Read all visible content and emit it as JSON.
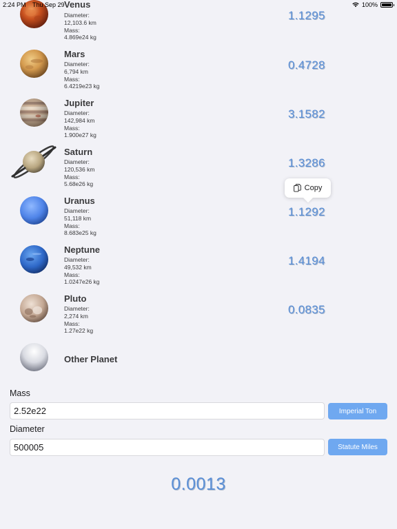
{
  "status_bar": {
    "time": "2:24 PM",
    "date": "Thu Sep 29",
    "battery": "100%"
  },
  "planets": [
    {
      "name": "Venus",
      "diameter_label": "Diameter:",
      "diameter": "12,103.6 km",
      "mass_label": "Mass:",
      "mass": "4.869e24 kg",
      "value": "1.1295"
    },
    {
      "name": "Mars",
      "diameter_label": "Diameter:",
      "diameter": "6,794 km",
      "mass_label": "Mass:",
      "mass": "6.4219e23 kg",
      "value": "0.4728"
    },
    {
      "name": "Jupiter",
      "diameter_label": "Diameter:",
      "diameter": "142,984 km",
      "mass_label": "Mass:",
      "mass": "1.900e27 kg",
      "value": "3.1582"
    },
    {
      "name": "Saturn",
      "diameter_label": "Diameter:",
      "diameter": "120,536 km",
      "mass_label": "Mass:",
      "mass": "5.68e26 kg",
      "value": "1.3286"
    },
    {
      "name": "Uranus",
      "diameter_label": "Diameter:",
      "diameter": "51,118 km",
      "mass_label": "Mass:",
      "mass": "8.683e25 kg",
      "value": "1.1292"
    },
    {
      "name": "Neptune",
      "diameter_label": "Diameter:",
      "diameter": "49,532 km",
      "mass_label": "Mass:",
      "mass": "1.0247e26 kg",
      "value": "1.4194"
    },
    {
      "name": "Pluto",
      "diameter_label": "Diameter:",
      "diameter": "2,274 km",
      "mass_label": "Mass:",
      "mass": "1.27e22 kg",
      "value": "0.0835"
    }
  ],
  "other_planet": {
    "name": "Other Planet"
  },
  "copy_popup": {
    "label": "Copy"
  },
  "mass_field": {
    "label": "Mass",
    "value": "2.52e22",
    "unit_button": "Imperial Ton"
  },
  "diameter_field": {
    "label": "Diameter",
    "value": "500005",
    "unit_button": "Statute Miles"
  },
  "result": {
    "value": "0.0013"
  },
  "colors": {
    "accent": "#5b8fd6",
    "button": "#6fa8f0",
    "background": "#f2f2f7"
  }
}
